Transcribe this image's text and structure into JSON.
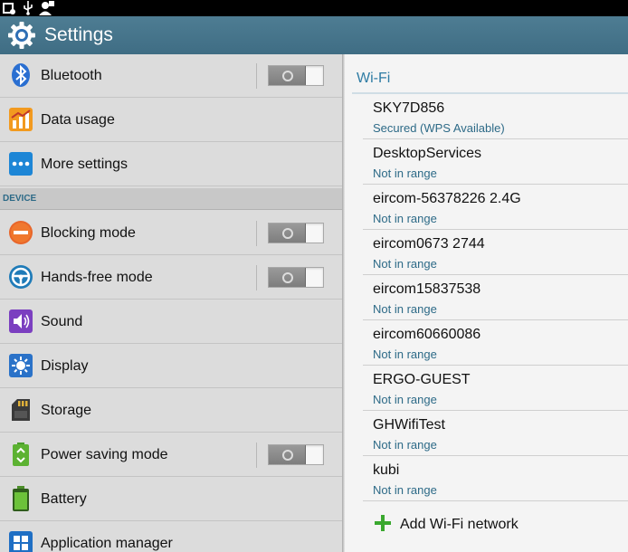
{
  "app": {
    "title": "Settings",
    "icon": "gear-icon"
  },
  "statusbar": {
    "icons": [
      "notification-icon",
      "usb-icon",
      "account-icon"
    ]
  },
  "settings": {
    "items_top": [
      {
        "label": "Bluetooth",
        "icon": "bluetooth-icon",
        "toggle": "off"
      },
      {
        "label": "Data usage",
        "icon": "data-usage-icon"
      },
      {
        "label": "More settings",
        "icon": "more-settings-icon"
      }
    ],
    "section_device": "DEVICE",
    "items_device": [
      {
        "label": "Blocking mode",
        "icon": "blocking-mode-icon",
        "toggle": "off"
      },
      {
        "label": "Hands-free mode",
        "icon": "hands-free-icon",
        "toggle": "off"
      },
      {
        "label": "Sound",
        "icon": "sound-icon"
      },
      {
        "label": "Display",
        "icon": "display-icon"
      },
      {
        "label": "Storage",
        "icon": "storage-icon"
      },
      {
        "label": "Power saving mode",
        "icon": "power-saving-icon",
        "toggle": "off"
      },
      {
        "label": "Battery",
        "icon": "battery-icon"
      },
      {
        "label": "Application manager",
        "icon": "application-manager-icon"
      }
    ]
  },
  "wifi": {
    "header": "Wi-Fi",
    "networks": [
      {
        "ssid": "SKY7D856",
        "status": "Secured (WPS Available)"
      },
      {
        "ssid": "DesktopServices",
        "status": "Not in range"
      },
      {
        "ssid": "eircom-56378226 2.4G",
        "status": "Not in range"
      },
      {
        "ssid": "eircom0673 2744",
        "status": "Not in range"
      },
      {
        "ssid": "eircom15837538",
        "status": "Not in range"
      },
      {
        "ssid": "eircom60660086",
        "status": "Not in range"
      },
      {
        "ssid": "ERGO-GUEST",
        "status": "Not in range"
      },
      {
        "ssid": "GHWifiTest",
        "status": "Not in range"
      },
      {
        "ssid": "kubi",
        "status": "Not in range"
      }
    ],
    "add_network": "Add Wi-Fi network"
  },
  "colors": {
    "accent": "#2e7ca4",
    "actionbar": "#46768c",
    "add_plus": "#3aa82e"
  }
}
